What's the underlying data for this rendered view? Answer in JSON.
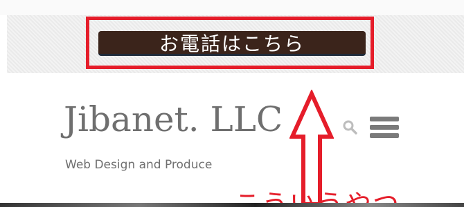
{
  "header": {
    "phone_button_label": "お電話はこちら"
  },
  "site": {
    "title": "Jibanet. LLC",
    "tagline": "Web Design and Produce"
  },
  "icons": {
    "search": "search-icon",
    "menu": "hamburger-menu-icon",
    "arrow": "up-arrow-icon"
  },
  "annotation": {
    "text": "こういうやつ"
  },
  "colors": {
    "annotation_red": "#e51d2a",
    "button_bg": "#3b241b",
    "title_gray": "#6f6f6f"
  }
}
